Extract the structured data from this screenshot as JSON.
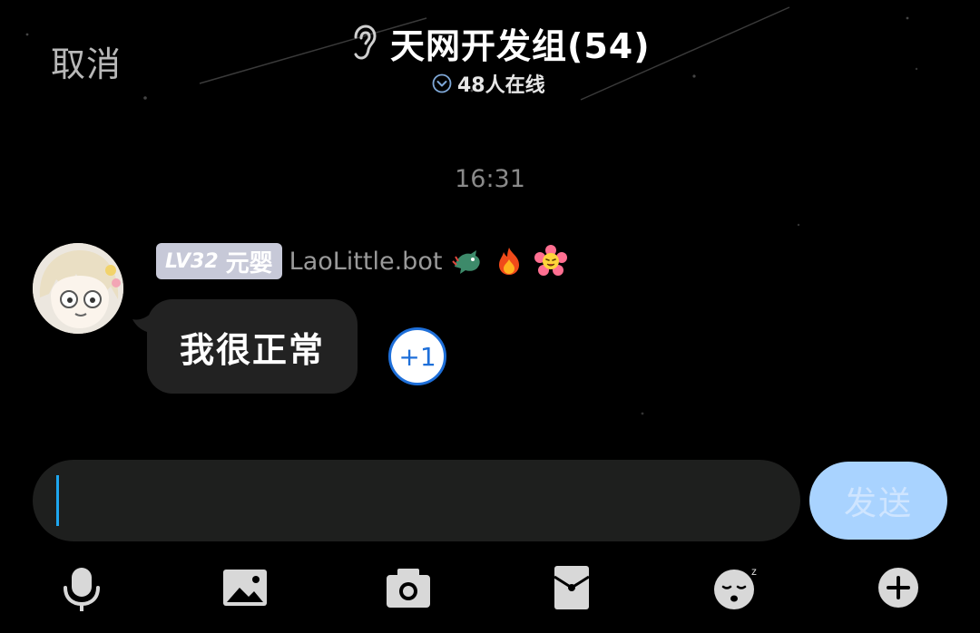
{
  "header": {
    "cancel_label": "取消",
    "title": "天网开发组(54)",
    "online_status": "48人在线"
  },
  "chat": {
    "timestamp": "16:31",
    "message": {
      "sender_level": "LV32",
      "sender_rank": "元婴",
      "sender_name": "LaoLittle.bot",
      "badges": [
        "dragon-emoji",
        "fire-emoji",
        "smiling-flower-emoji"
      ],
      "text": "我很正常",
      "plus_one_label": "+1"
    }
  },
  "composer": {
    "input_value": "",
    "send_label": "发送"
  },
  "toolbar": {
    "icons": [
      "microphone-icon",
      "image-icon",
      "camera-icon",
      "red-packet-icon",
      "sleepy-emoji-icon",
      "plus-circle-icon"
    ]
  },
  "colors": {
    "background": "#000000",
    "bubble": "#222222",
    "send_button": "#a9d3ff",
    "accent": "#1e6fd9",
    "caret": "#1ea7f0"
  }
}
